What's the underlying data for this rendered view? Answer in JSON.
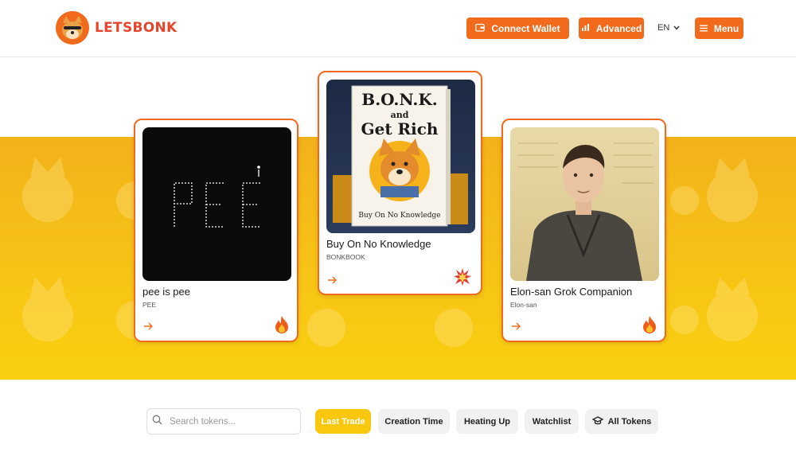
{
  "header": {
    "logo_text": "LETSBONK",
    "connect_wallet_label": "Connect Wallet",
    "advanced_label": "Advanced",
    "language": "EN",
    "menu_label": "Menu"
  },
  "colors": {
    "accent": "#f26b1d",
    "brand_red": "#e5452a",
    "banner_yellow": "#f7c316",
    "active_chip": "#f9c80e"
  },
  "cards": [
    {
      "title": "pee is pee",
      "ticker": "PEE",
      "image_text": "PEE",
      "badge": "fire-icon"
    },
    {
      "title": "Buy On No Knowledge",
      "ticker": "BONKBOOK",
      "book_title_1": "B.O.N.K.",
      "book_title_2": "and",
      "book_title_3": "Get Rich",
      "book_subtitle": "Buy On No Knowledge",
      "badge": "explosion-icon"
    },
    {
      "title": "Elon-san Grok Companion",
      "ticker": "Elon-san",
      "badge": "fire-icon"
    }
  ],
  "search": {
    "placeholder": "Search tokens..."
  },
  "filters": [
    {
      "label": "Last Trade",
      "active": true
    },
    {
      "label": "Creation Time",
      "active": false
    },
    {
      "label": "Heating Up",
      "active": false
    },
    {
      "label": "Watchlist",
      "active": false
    },
    {
      "label": "All Tokens",
      "active": false
    }
  ]
}
